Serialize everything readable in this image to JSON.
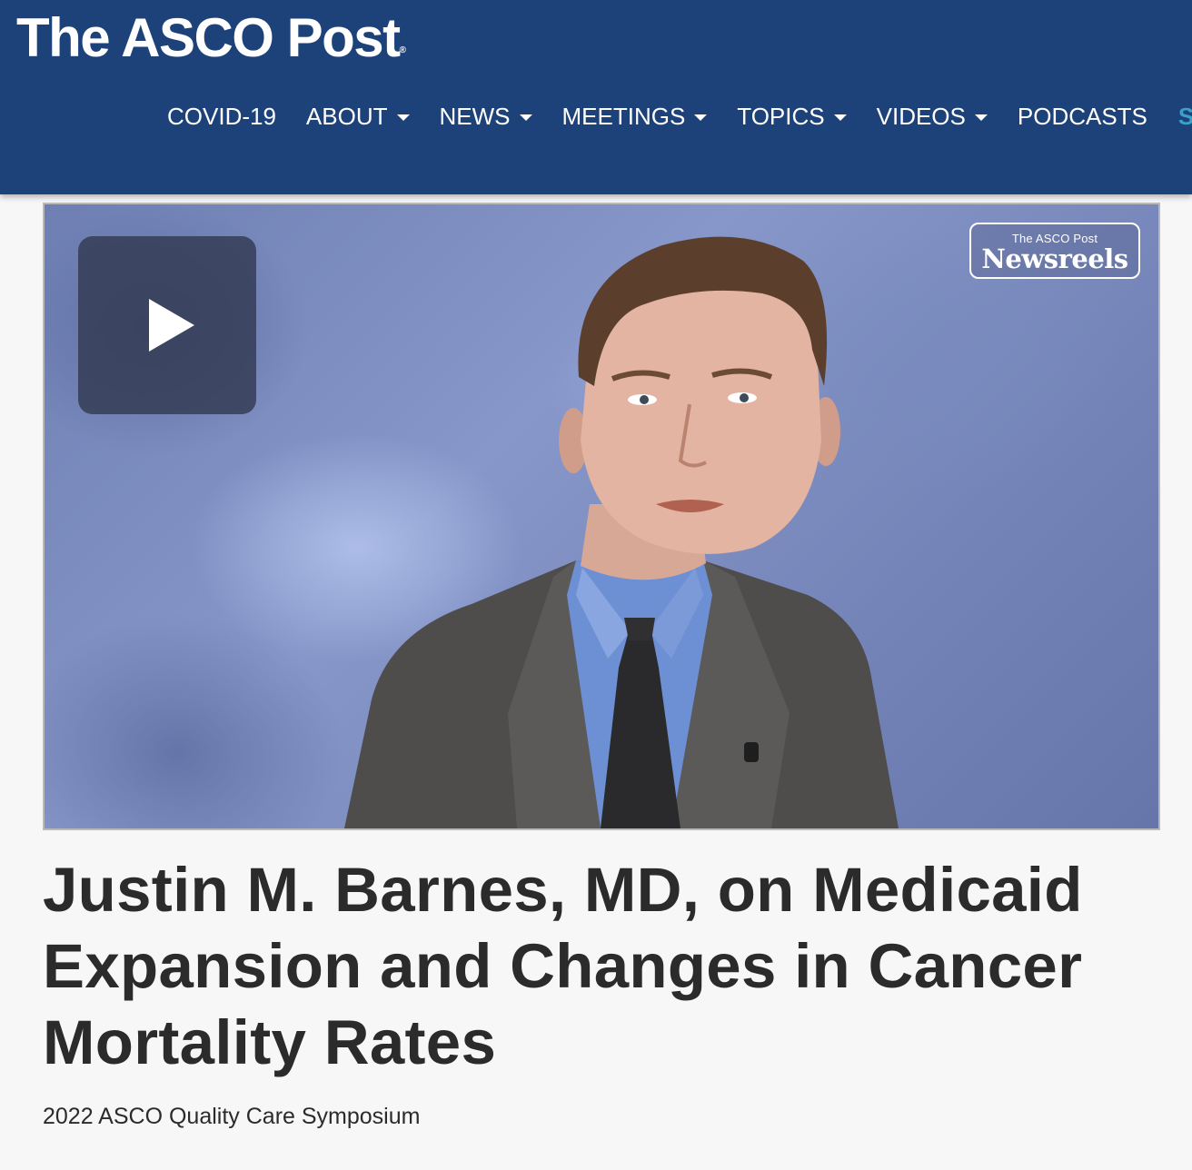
{
  "header": {
    "logo_text": "The ASCO Post",
    "logo_mark": "®",
    "nav": [
      {
        "label": "COVID-19",
        "dropdown": false
      },
      {
        "label": "ABOUT",
        "dropdown": true
      },
      {
        "label": "NEWS",
        "dropdown": true
      },
      {
        "label": "MEETINGS",
        "dropdown": true
      },
      {
        "label": "TOPICS",
        "dropdown": true
      },
      {
        "label": "VIDEOS",
        "dropdown": true
      },
      {
        "label": "PODCASTS",
        "dropdown": false
      }
    ],
    "nav_overflow": "S",
    "colors": {
      "bar": "#1c4279",
      "overflow": "#3aa0c8"
    }
  },
  "video": {
    "play_icon": "play-icon",
    "badge_small": "The ASCO Post",
    "badge_big": "Newsreels"
  },
  "article": {
    "title": "Justin M. Barnes, MD, on Medicaid Expansion and Changes in Cancer Mortality Rates",
    "subtitle": "2022 ASCO Quality Care Symposium"
  }
}
